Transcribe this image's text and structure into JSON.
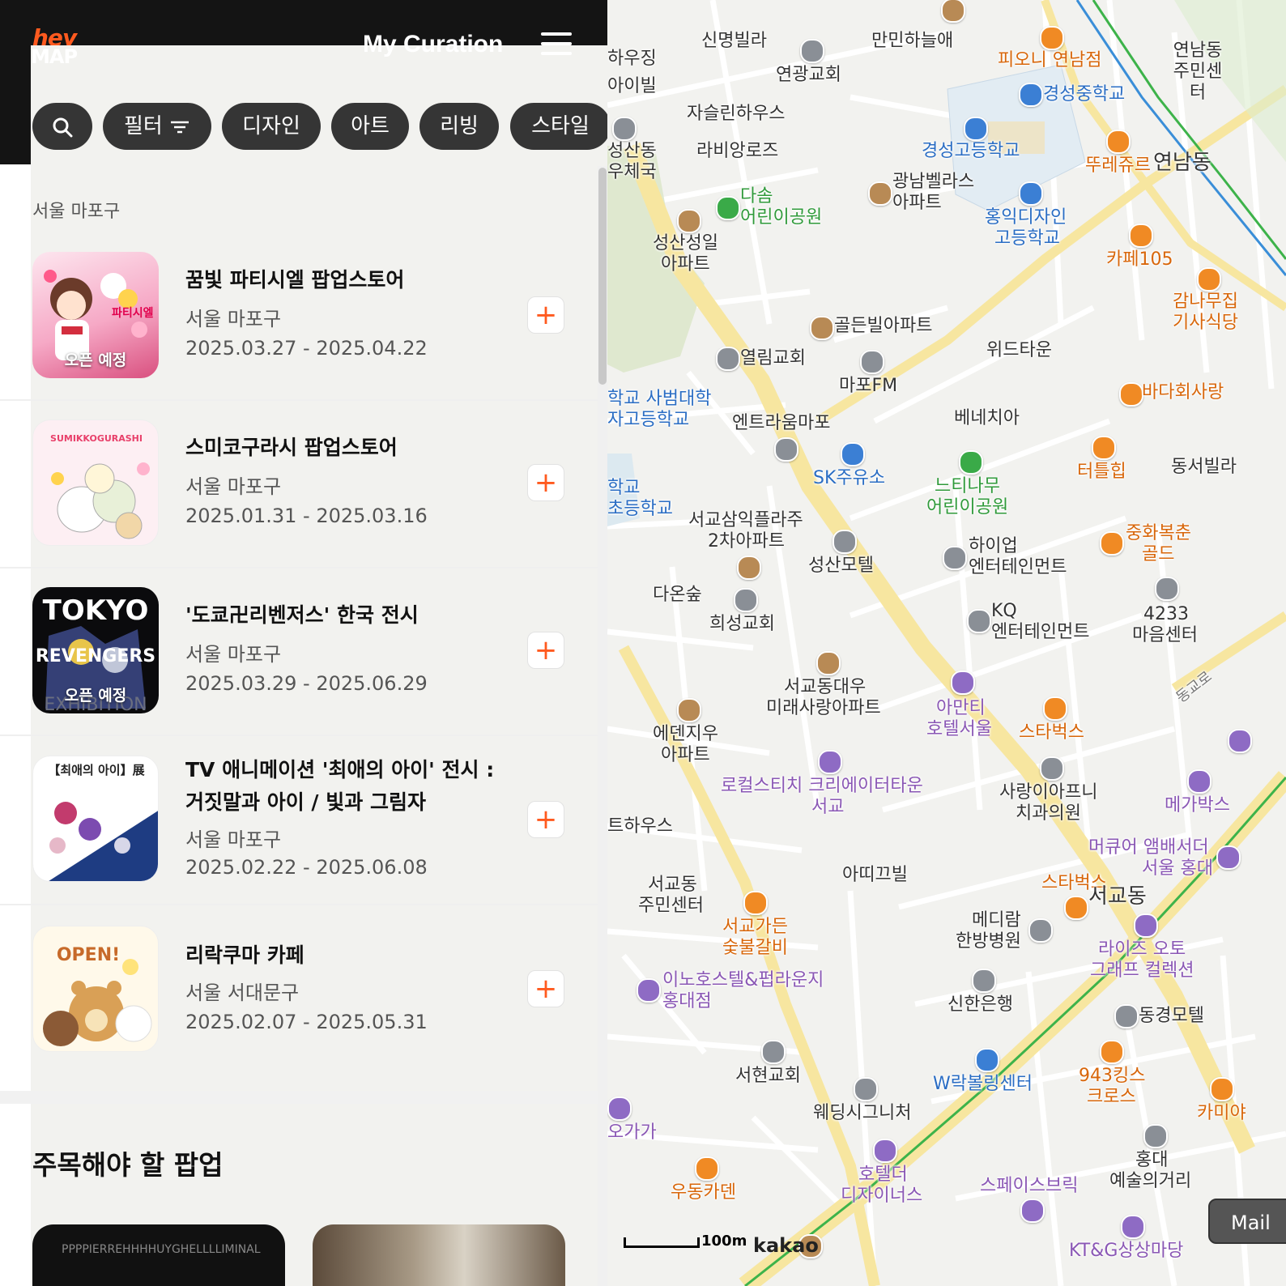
{
  "header": {
    "logo_top": "hey",
    "logo_bottom": "MAP",
    "title": "My Curation"
  },
  "filters": {
    "filter_label": "필터",
    "chips": [
      "디자인",
      "아트",
      "리빙",
      "스타일"
    ]
  },
  "region": "서울 마포구",
  "items": [
    {
      "name": "꿈빛 파티시엘 팝업스토어",
      "location": "서울 마포구",
      "dates": "2025.03.27 - 2025.04.22",
      "badge": "오픈 예정"
    },
    {
      "name": "스미코구라시 팝업스토어",
      "location": "서울 마포구",
      "dates": "2025.01.31 - 2025.03.16",
      "badge": ""
    },
    {
      "name": "'도쿄卍리벤저스' 한국 전시",
      "location": "서울 마포구",
      "dates": "2025.03.29 - 2025.06.29",
      "badge": "오픈 예정"
    },
    {
      "name": "TV 애니메이션 '최애의 아이' 전시 : 거짓말과 아이 / 빛과 그림자",
      "location": "서울 마포구",
      "dates": "2025.02.22 - 2025.06.08",
      "badge": ""
    },
    {
      "name": "리락쿠마 카페",
      "location": "서울 서대문구",
      "dates": "2025.02.07 - 2025.05.31",
      "badge": ""
    }
  ],
  "plus_label": "+",
  "section_title": "주목해야 할 팝업",
  "cards": [
    {
      "text": "PPPPIERREHHHHUYGHELLLLIMINAL"
    },
    {
      "text": ""
    }
  ],
  "thumb_texts": {
    "thumb1": "파티시엘",
    "thumb2": "SUMIKKOGURASHI",
    "thumb3_top": "TOKYO",
    "thumb3_mid": "REVENGERS",
    "thumb3_bottom": "EXHIBITION",
    "thumb4": "【최애의 아이】展",
    "thumb5": "OPEN!"
  },
  "map": {
    "labels": [
      "신명빌라",
      "만민하늘애",
      "피오니 연남점",
      "연남동 주민센터",
      "하우징",
      "아이빌",
      "연광교회",
      "경성중학교",
      "자슬린하우스",
      "라비앙로즈",
      "경성고등학교",
      "뚜레쥬르",
      "연남동",
      "성산동",
      "우체국",
      "광남벨라스",
      "아파트",
      "다솜",
      "어린이공원",
      "홍익디자인",
      "고등학교",
      "성산성일",
      "아파트",
      "카페105",
      "감나무집",
      "기사식당",
      "골든빌아파트",
      "열림교회",
      "마포FM",
      "위드타운",
      "바다회사랑",
      "학교 사범대학",
      "자고등학교",
      "엔트라움마포",
      "베네치아",
      "SK주유소",
      "느티나무",
      "어린이공원",
      "터틀힙",
      "동서빌라",
      "학교",
      "초등학교",
      "서교삼익플라주",
      "2차아파트",
      "성산모텔",
      "하이업",
      "엔터테인먼트",
      "중화복춘",
      "골드",
      "다온숲",
      "희성교회",
      "KQ",
      "엔터테인먼트",
      "4233",
      "마음센터",
      "서교동대우",
      "미래사랑아파트",
      "아만티",
      "호텔서울",
      "스타벅스",
      "에덴지우",
      "아파트",
      "로컬스티치 크리에이터타운",
      "서교",
      "사랑이아프니",
      "치과의원",
      "메가박스",
      "트하우스",
      "머큐어 앰배서더",
      "서울 홍대",
      "서교동",
      "주민센터",
      "아띠끄빌",
      "스타벅스",
      "서교동",
      "서교가든",
      "숯불갈비",
      "메디람",
      "한방병원",
      "라이즈 오토",
      "그래프 컬렉션",
      "이노호스텔&펍라운지",
      "홍대점",
      "신한은행",
      "동경모텔",
      "서현교회",
      "W락볼링센터",
      "943킹스",
      "크로스",
      "카미야",
      "오가가",
      "웨딩시그니처",
      "홍대",
      "예술의거리",
      "호텔더",
      "디자이너스",
      "스페이스브릭",
      "우동카덴",
      "KT&G상상마당",
      "동교로"
    ],
    "scale_label": "100m",
    "brand": "kakao",
    "mail_button": "Mail"
  },
  "colors": {
    "accent": "#ff5a1f",
    "header_bg": "#141414",
    "chip_bg": "#353535",
    "road_yellow": "#f7e6a0",
    "subway_green": "#3db34a",
    "subway_blue": "#3a8ed8"
  },
  "icons": [
    "search-icon",
    "filter-icon",
    "menu-icon",
    "plus-icon"
  ]
}
